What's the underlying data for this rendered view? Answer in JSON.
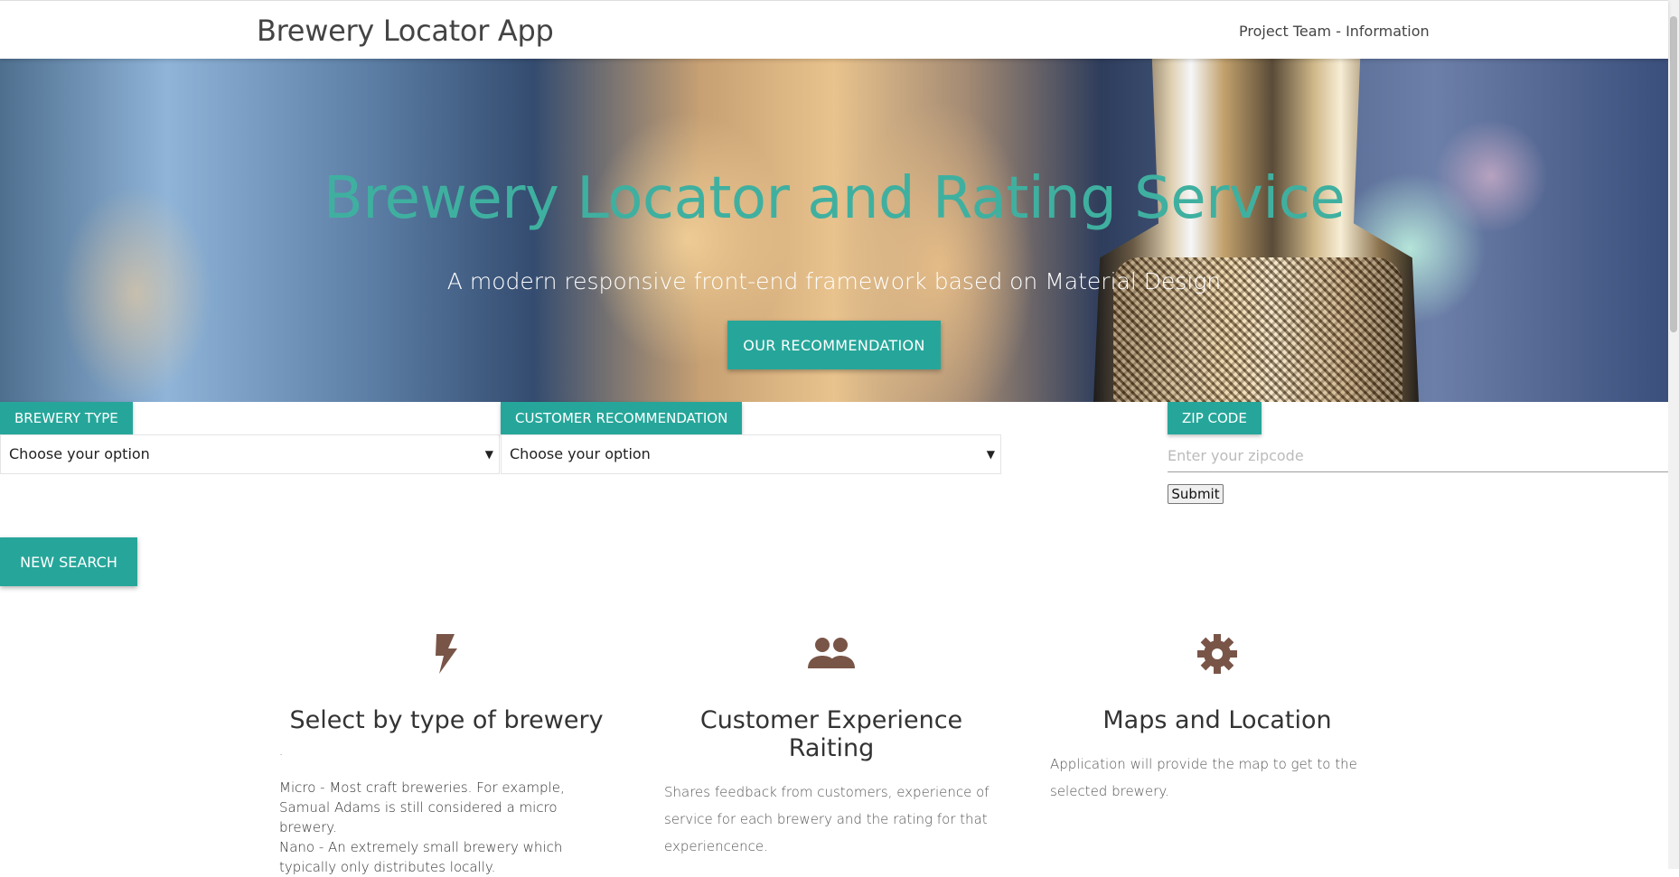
{
  "navbar": {
    "brand": "Brewery Locator App",
    "link": "Project Team - Information"
  },
  "hero": {
    "title": "Brewery Locator and Rating Service",
    "subtitle": "A modern responsive front-end framework based on Material Design",
    "button_label": "OUR RECOMMENDATION"
  },
  "filters": {
    "brewery_type": {
      "label": "BREWERY TYPE",
      "selected": "Choose your option"
    },
    "customer_recommendation": {
      "label": "CUSTOMER RECOMMENDATION",
      "selected": "Choose your option"
    },
    "zip": {
      "label": "ZIP CODE",
      "placeholder": "Enter your zipcode",
      "submit_label": "Submit"
    },
    "new_search_label": "NEW SEARCH"
  },
  "features": [
    {
      "icon": "bolt-icon",
      "title": "Select by type of brewery",
      "dot": ".",
      "lines": [
        "Micro - Most craft breweries. For example, Samual Adams is still considered a micro brewery.",
        "Nano - An extremely small brewery which typically only distributes locally."
      ]
    },
    {
      "icon": "group-icon",
      "title": "Customer Experience Raiting",
      "text": "Shares feedback from customers, experience of service for each brewery and the rating for that experiencence."
    },
    {
      "icon": "gear-icon",
      "title": "Maps and Location",
      "text": "Application will provide the map to get to the selected brewery."
    }
  ],
  "colors": {
    "accent": "#26a69a",
    "hero_title": "#3fb0a0",
    "icon": "#795548"
  }
}
